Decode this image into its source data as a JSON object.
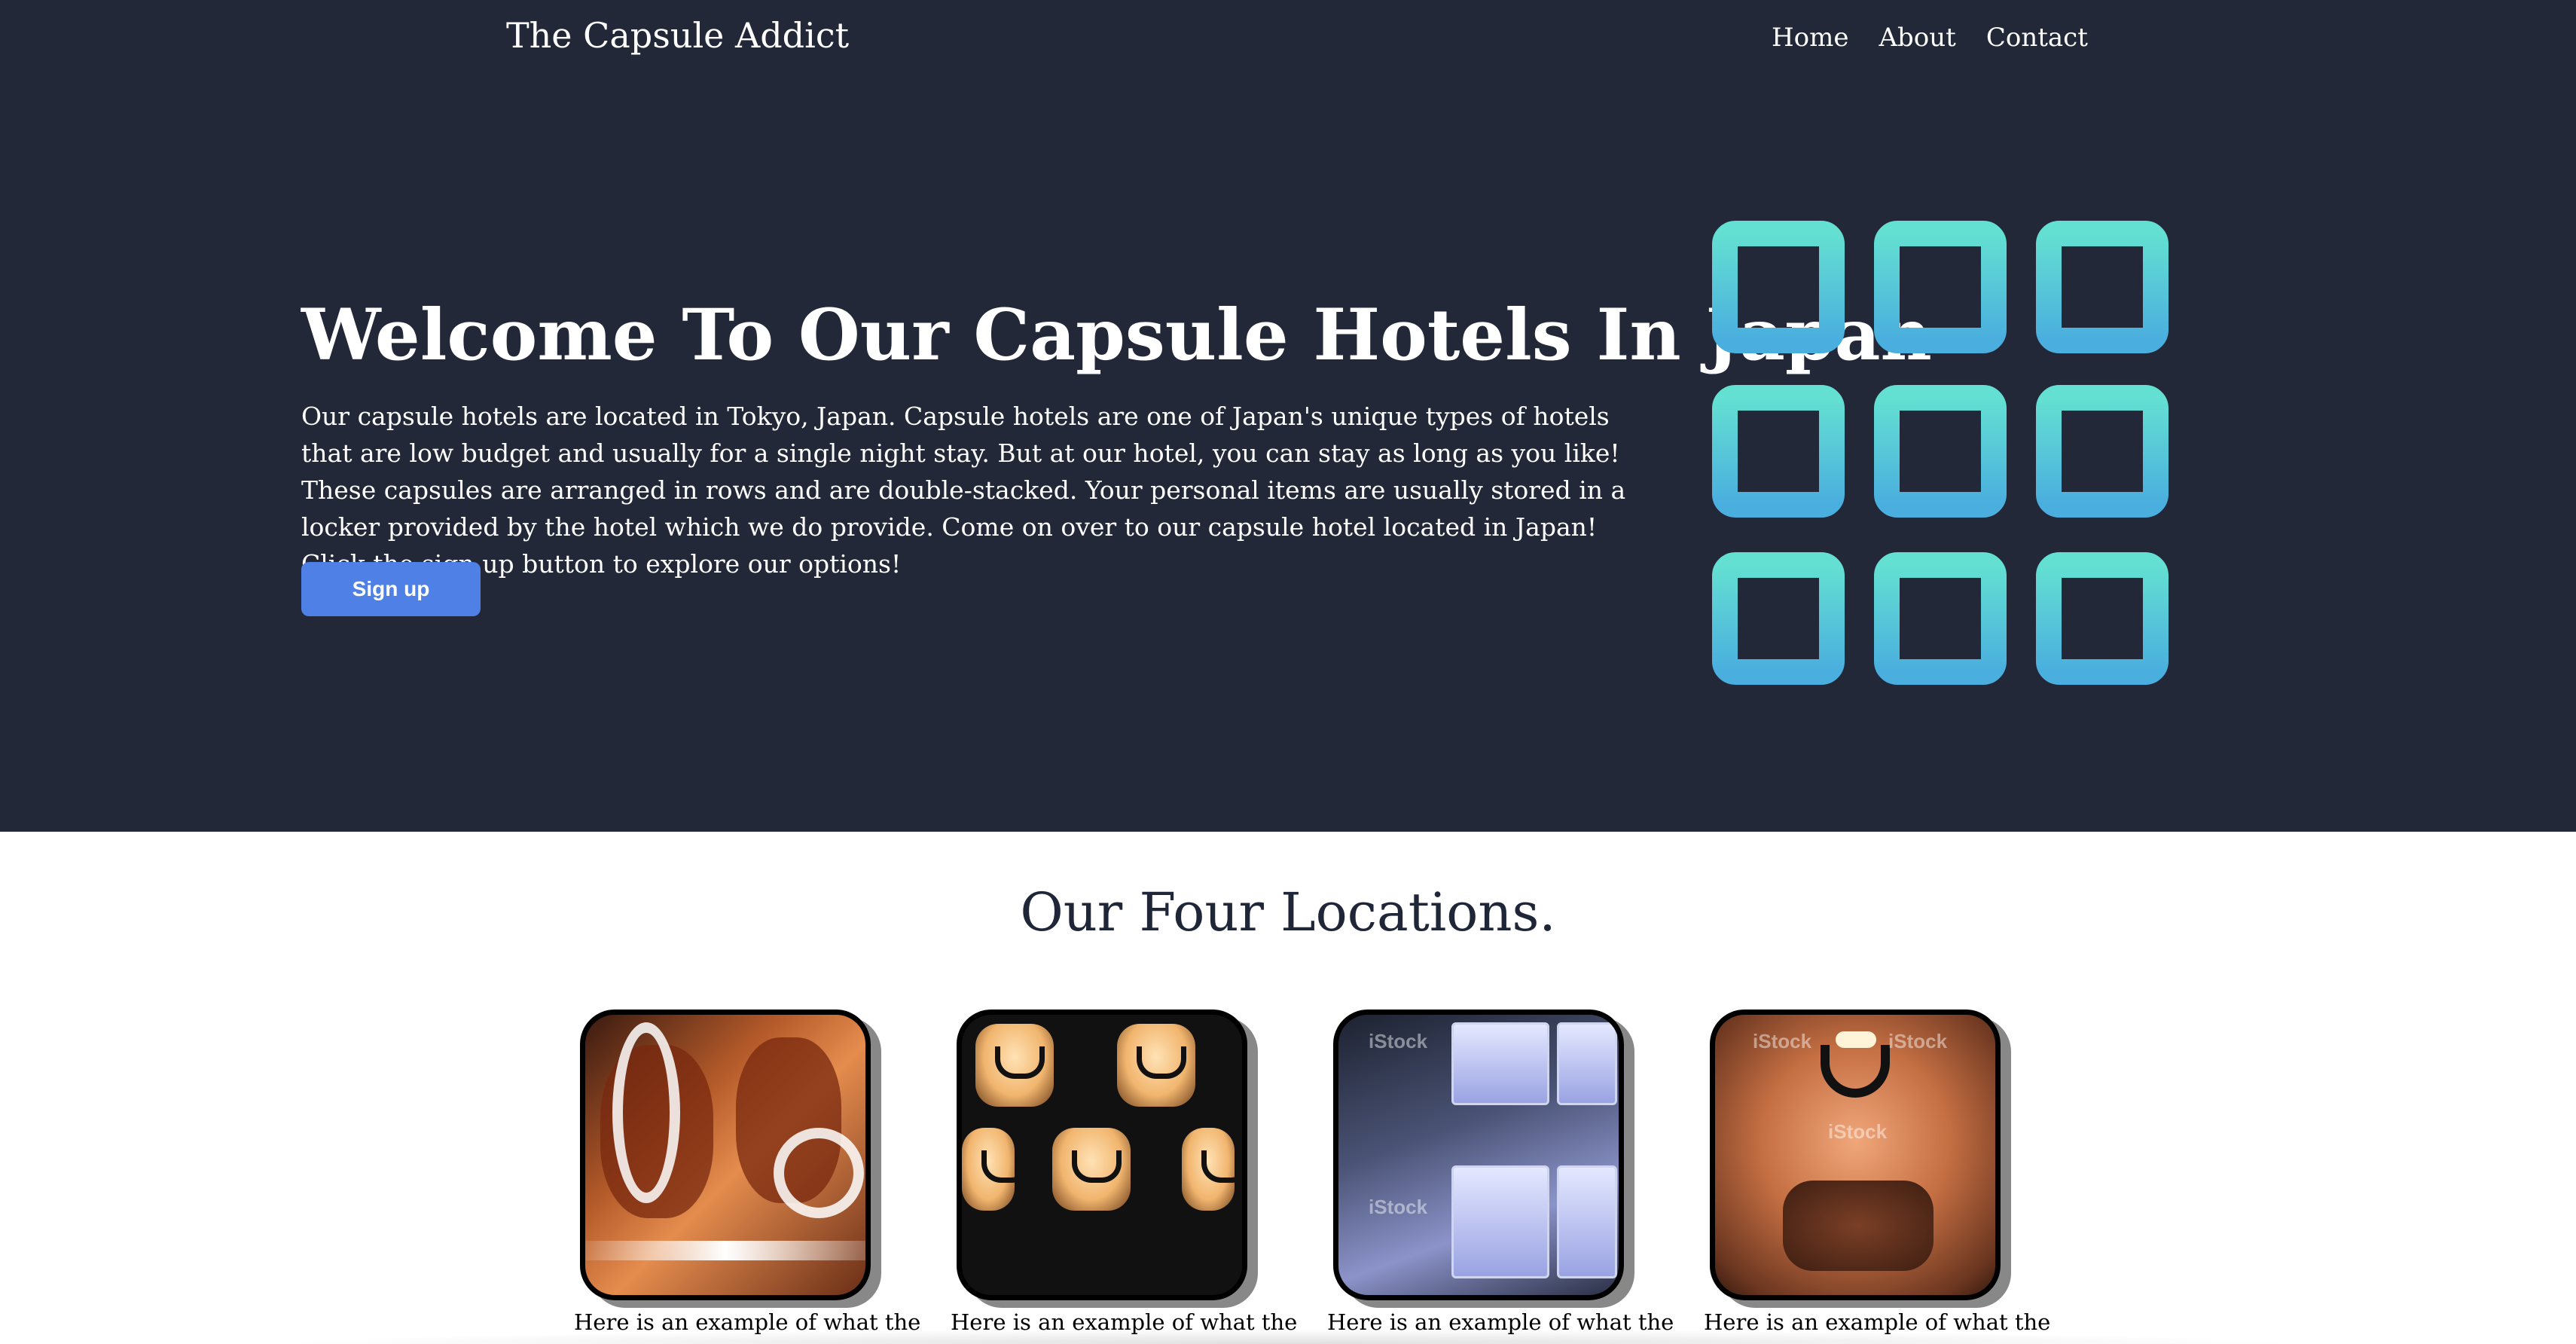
{
  "header": {
    "brand": "The Capsule Addict",
    "nav": [
      "Home",
      "About",
      "Contact"
    ]
  },
  "hero": {
    "title": "Welcome To Our Capsule Hotels In Japan",
    "text": "Our capsule hotels are located in Tokyo, Japan. Capsule hotels are one of Japan's unique types of hotels that are low budget and usually for a single night stay. But at our hotel, you can stay as long as you like! These capsules are arranged in rows and are double-stacked. Your personal items are usually stored in a locker provided by the hotel which we do provide. Come on over to our capsule hotel located in Japan! Click the sign up button to explore our options!",
    "signup_label": "Sign up",
    "logo_icon": "grid-3x3-icon"
  },
  "locations": {
    "title": "Our Four Locations.",
    "cards": [
      {
        "caption": "Here is an example of what the",
        "watermark": ""
      },
      {
        "caption": "Here is an example of what the",
        "watermark": ""
      },
      {
        "caption": "Here is an example of what the",
        "watermark": "iStock"
      },
      {
        "caption": "Here is an example of what the",
        "watermark": "iStock"
      }
    ]
  },
  "colors": {
    "hero_bg": "#222837",
    "button": "#4f80e6",
    "logo_top": "#64e0d2",
    "logo_bottom": "#4aaede",
    "heading": "#1f2638"
  }
}
